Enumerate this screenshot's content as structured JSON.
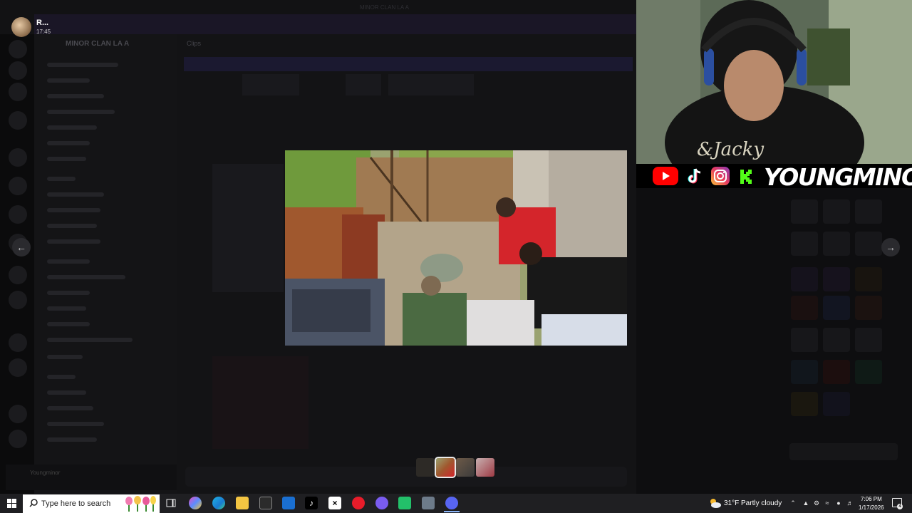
{
  "background": {
    "window_title": "MINOR CLAN LA A",
    "server_name": "MINOR CLAN LA A",
    "channel_header": "Clips",
    "user_name": "Youngminor"
  },
  "post": {
    "author": "R...",
    "time": "17:45"
  },
  "viewer": {
    "prev_icon": "arrow-left-icon",
    "next_icon": "arrow-right-icon",
    "thumbnails": 4,
    "active_thumbnail": 2
  },
  "stream_overlay": {
    "brand": "YOUNGMINOR",
    "socials": [
      "youtube-icon",
      "tiktok-icon",
      "instagram-icon",
      "kick-icon"
    ]
  },
  "taskbar": {
    "search_placeholder": "Type here to search",
    "weather": "31°F  Partly cloudy",
    "time": "7:06 PM",
    "date": "1/17/2026",
    "notification_count": "4"
  }
}
